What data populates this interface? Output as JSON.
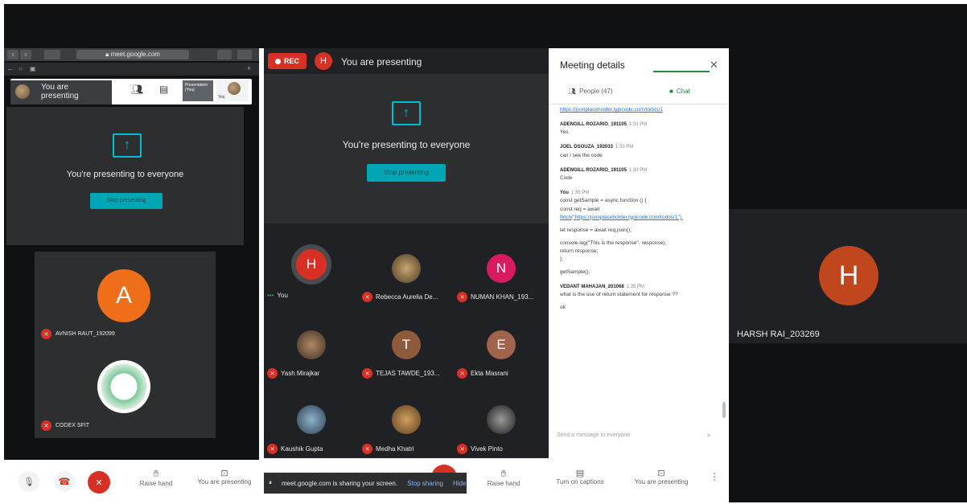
{
  "browser": {
    "url": "meet.google.com"
  },
  "left_pane": {
    "presenting_label": "You are presenting",
    "share_message": "You're presenting to everyone",
    "stop_button": "Stop presenting",
    "tiles": [
      {
        "initial": "A",
        "name": "AVNISH RAUT_192099",
        "color": "#ee6e19"
      },
      {
        "initial": "",
        "name": "CODEX SFIT"
      }
    ],
    "controls": {
      "raise_hand": "Raise hand",
      "presenting": "You are presenting"
    }
  },
  "middle_pane": {
    "rec_label": "REC",
    "presenter_initial": "H",
    "presenting_label": "You are presenting",
    "share_message": "You're presenting to everyone",
    "stop_button": "Stop presenting",
    "participants": [
      {
        "initial": "H",
        "name": "You",
        "color": "#d93025",
        "self": true
      },
      {
        "initial": "",
        "name": "Rebecca Aurelia De...",
        "photo": true
      },
      {
        "initial": "N",
        "name": "NUMAN KHAN_193...",
        "color": "#d81b60"
      },
      {
        "initial": "",
        "name": "Yash Mirajkar",
        "photo": true
      },
      {
        "initial": "T",
        "name": "TEJAS TAWDE_193...",
        "color": "#8d5a3c"
      },
      {
        "initial": "E",
        "name": "Ekta Masrani",
        "color": "#a0634c"
      },
      {
        "initial": "",
        "name": "Kaushik Gupta",
        "photo": true
      },
      {
        "initial": "",
        "name": "Medha Khatri",
        "photo": true
      },
      {
        "initial": "",
        "name": "Vivek Pinto",
        "photo": true
      }
    ],
    "share_toast": {
      "text": "meet.google.com is sharing your screen.",
      "stop": "Stop sharing",
      "hide": "Hide"
    },
    "controls": {
      "raise_hand": "Raise hand",
      "captions": "Turn on captions",
      "presenting": "You are presenting"
    }
  },
  "chat": {
    "title": "Meeting details",
    "tab_people": "People (47)",
    "tab_chat": "Chat",
    "link_top": "https://jsonplaceholder.typicode.com/todos/1",
    "messages": [
      {
        "sender": "ADENGILL ROZARIO_191105",
        "time": "1:33 PM",
        "text": "Yes"
      },
      {
        "sender": "JOEL DSOUZA_192033",
        "time": "1:33 PM",
        "text": "can i see the code"
      },
      {
        "sender": "ADENGILL ROZARIO_191105",
        "time": "1:33 PM",
        "text": "Code"
      },
      {
        "sender": "You",
        "time": "1:33 PM",
        "code": [
          "const getSample = async function () {",
          "  const req = await",
          "fetch(\"https://jsonplaceholder.typicode.com/todos/1\");",
          "",
          "  let response = await req.json();",
          "",
          "  console.log(\"This is the response\", response);",
          "  return response;",
          "};",
          "",
          "getSample();"
        ]
      },
      {
        "sender": "VEDANT MAHAJAN_201068",
        "time": "1:35 PM",
        "text": "what is the use of return statement for response ??",
        "extra": "ok"
      }
    ],
    "input_placeholder": "Send a message to everyone"
  },
  "right_pane": {
    "initial": "H",
    "name": "HARSH RAI_203269",
    "color": "#c0461e"
  }
}
